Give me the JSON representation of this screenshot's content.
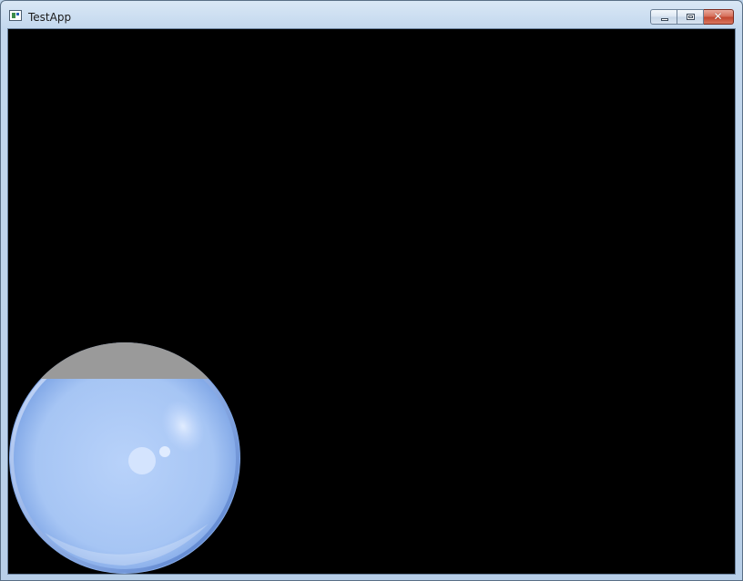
{
  "window": {
    "title": "TestApp"
  },
  "icons": {
    "app": "app-window-icon",
    "minimize": "minimize-icon",
    "maximize": "maximize-icon",
    "close": "close-icon"
  },
  "controls": {
    "close_glyph": "✕"
  },
  "colors": {
    "client_background": "#000000",
    "close_button": "#c84a32",
    "bubble_fill": "#a9c8f5",
    "bubble_cap": "#9a9a9a"
  },
  "scene": {
    "bubble": "translucent-blue-sphere"
  }
}
